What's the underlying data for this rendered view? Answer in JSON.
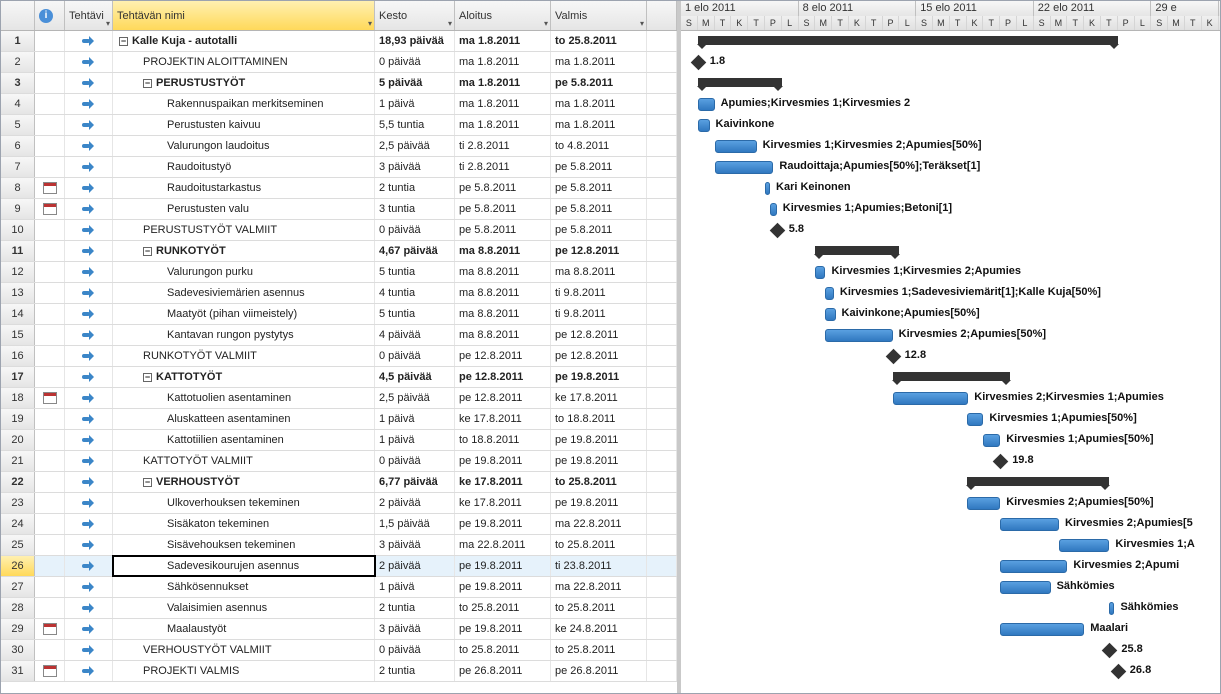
{
  "info_glyph": "i",
  "columns": {
    "rownum": "",
    "info": "",
    "tehtavi": "Tehtävi",
    "nimi": "Tehtävän nimi",
    "kesto": "Kesto",
    "aloitus": "Aloitus",
    "valmis": "Valmis"
  },
  "collapse_glyph": "−",
  "timeline": {
    "weeks": [
      {
        "label": "1 elo 2011",
        "days": 7
      },
      {
        "label": "8 elo 2011",
        "days": 7
      },
      {
        "label": "15 elo 2011",
        "days": 7
      },
      {
        "label": "22 elo 2011",
        "days": 7
      },
      {
        "label": "29 e",
        "days": 4
      }
    ],
    "day_letters": [
      "S",
      "M",
      "T",
      "K",
      "T",
      "P",
      "L"
    ]
  },
  "selected_row": 26,
  "rows": [
    {
      "n": 1,
      "bold": true,
      "indent": 0,
      "collapse": true,
      "name": "Kalle Kuja - autotalli",
      "kesto": "18,93 päivää",
      "aloitus": "ma 1.8.2011",
      "valmis": "to 25.8.2011",
      "bar": {
        "type": "summary",
        "start": 1,
        "len": 25
      },
      "label": ""
    },
    {
      "n": 2,
      "indent": 1,
      "name": "PROJEKTIN ALOITTAMINEN",
      "kesto": "0 päivää",
      "aloitus": "ma 1.8.2011",
      "valmis": "ma 1.8.2011",
      "bar": {
        "type": "milestone",
        "start": 1
      },
      "label": "1.8"
    },
    {
      "n": 3,
      "bold": true,
      "indent": 1,
      "collapse": true,
      "name": "PERUSTUSTYÖT",
      "kesto": "5 päivää",
      "aloitus": "ma 1.8.2011",
      "valmis": "pe 5.8.2011",
      "bar": {
        "type": "summary",
        "start": 1,
        "len": 5
      },
      "label": ""
    },
    {
      "n": 4,
      "indent": 2,
      "name": "Rakennuspaikan merkitseminen",
      "kesto": "1 päivä",
      "aloitus": "ma 1.8.2011",
      "valmis": "ma 1.8.2011",
      "bar": {
        "type": "task",
        "start": 1,
        "len": 1
      },
      "label": "Apumies;Kirvesmies 1;Kirvesmies 2"
    },
    {
      "n": 5,
      "indent": 2,
      "name": "Perustusten kaivuu",
      "kesto": "5,5 tuntia",
      "aloitus": "ma 1.8.2011",
      "valmis": "ma 1.8.2011",
      "bar": {
        "type": "task",
        "start": 1,
        "len": 0.7
      },
      "label": "Kaivinkone"
    },
    {
      "n": 6,
      "indent": 2,
      "name": "Valurungon laudoitus",
      "kesto": "2,5 päivää",
      "aloitus": "ti 2.8.2011",
      "valmis": "to 4.8.2011",
      "bar": {
        "type": "task",
        "start": 2,
        "len": 2.5
      },
      "label": "Kirvesmies 1;Kirvesmies 2;Apumies[50%]"
    },
    {
      "n": 7,
      "indent": 2,
      "name": "Raudoitustyö",
      "kesto": "3 päivää",
      "aloitus": "ti 2.8.2011",
      "valmis": "pe 5.8.2011",
      "bar": {
        "type": "task",
        "start": 2,
        "len": 3.5
      },
      "label": "Raudoittaja;Apumies[50%];Teräkset[1]"
    },
    {
      "n": 8,
      "cal": true,
      "indent": 2,
      "name": "Raudoitustarkastus",
      "kesto": "2 tuntia",
      "aloitus": "pe 5.8.2011",
      "valmis": "pe 5.8.2011",
      "bar": {
        "type": "task",
        "start": 5,
        "len": 0.3
      },
      "label": "Kari Keinonen"
    },
    {
      "n": 9,
      "cal": true,
      "indent": 2,
      "name": "Perustusten valu",
      "kesto": "3 tuntia",
      "aloitus": "pe 5.8.2011",
      "valmis": "pe 5.8.2011",
      "bar": {
        "type": "task",
        "start": 5.3,
        "len": 0.4
      },
      "label": "Kirvesmies 1;Apumies;Betoni[1]"
    },
    {
      "n": 10,
      "indent": 1,
      "name": "PERUSTUSTYÖT VALMIIT",
      "kesto": "0 päivää",
      "aloitus": "pe 5.8.2011",
      "valmis": "pe 5.8.2011",
      "bar": {
        "type": "milestone",
        "start": 5.7
      },
      "label": "5.8"
    },
    {
      "n": 11,
      "bold": true,
      "indent": 1,
      "collapse": true,
      "name": "RUNKOTYÖT",
      "kesto": "4,67 päivää",
      "aloitus": "ma 8.8.2011",
      "valmis": "pe 12.8.2011",
      "bar": {
        "type": "summary",
        "start": 8,
        "len": 5
      },
      "label": ""
    },
    {
      "n": 12,
      "indent": 2,
      "name": "Valurungon purku",
      "kesto": "5 tuntia",
      "aloitus": "ma 8.8.2011",
      "valmis": "ma 8.8.2011",
      "bar": {
        "type": "task",
        "start": 8,
        "len": 0.6
      },
      "label": "Kirvesmies 1;Kirvesmies 2;Apumies"
    },
    {
      "n": 13,
      "indent": 2,
      "name": "Sadevesiviemärien asennus",
      "kesto": "4 tuntia",
      "aloitus": "ma 8.8.2011",
      "valmis": "ti 9.8.2011",
      "bar": {
        "type": "task",
        "start": 8.6,
        "len": 0.5
      },
      "label": "Kirvesmies 1;Sadevesiviemärit[1];Kalle Kuja[50%]"
    },
    {
      "n": 14,
      "indent": 2,
      "name": "Maatyöt (pihan viimeistely)",
      "kesto": "5 tuntia",
      "aloitus": "ma 8.8.2011",
      "valmis": "ti 9.8.2011",
      "bar": {
        "type": "task",
        "start": 8.6,
        "len": 0.6
      },
      "label": "Kaivinkone;Apumies[50%]"
    },
    {
      "n": 15,
      "indent": 2,
      "name": "Kantavan rungon pystytys",
      "kesto": "4 päivää",
      "aloitus": "ma 8.8.2011",
      "valmis": "pe 12.8.2011",
      "bar": {
        "type": "task",
        "start": 8.6,
        "len": 4
      },
      "label": "Kirvesmies 2;Apumies[50%]"
    },
    {
      "n": 16,
      "indent": 1,
      "name": "RUNKOTYÖT VALMIIT",
      "kesto": "0 päivää",
      "aloitus": "pe 12.8.2011",
      "valmis": "pe 12.8.2011",
      "bar": {
        "type": "milestone",
        "start": 12.6
      },
      "label": "12.8"
    },
    {
      "n": 17,
      "bold": true,
      "indent": 1,
      "collapse": true,
      "name": "KATTOTYÖT",
      "kesto": "4,5 päivää",
      "aloitus": "pe 12.8.2011",
      "valmis": "pe 19.8.2011",
      "bar": {
        "type": "summary",
        "start": 12.6,
        "len": 7
      },
      "label": ""
    },
    {
      "n": 18,
      "cal": true,
      "indent": 2,
      "name": "Kattotuolien asentaminen",
      "kesto": "2,5 päivää",
      "aloitus": "pe 12.8.2011",
      "valmis": "ke 17.8.2011",
      "bar": {
        "type": "task",
        "start": 12.6,
        "len": 4.5
      },
      "label": "Kirvesmies 2;Kirvesmies 1;Apumies"
    },
    {
      "n": 19,
      "indent": 2,
      "name": "Aluskatteen asentaminen",
      "kesto": "1 päivä",
      "aloitus": "ke 17.8.2011",
      "valmis": "to 18.8.2011",
      "bar": {
        "type": "task",
        "start": 17,
        "len": 1
      },
      "label": "Kirvesmies 1;Apumies[50%]"
    },
    {
      "n": 20,
      "indent": 2,
      "name": "Kattotiilien asentaminen",
      "kesto": "1 päivä",
      "aloitus": "to 18.8.2011",
      "valmis": "pe 19.8.2011",
      "bar": {
        "type": "task",
        "start": 18,
        "len": 1
      },
      "label": "Kirvesmies 1;Apumies[50%]"
    },
    {
      "n": 21,
      "indent": 1,
      "name": "KATTOTYÖT VALMIIT",
      "kesto": "0 päivää",
      "aloitus": "pe 19.8.2011",
      "valmis": "pe 19.8.2011",
      "bar": {
        "type": "milestone",
        "start": 19
      },
      "label": "19.8"
    },
    {
      "n": 22,
      "bold": true,
      "indent": 1,
      "collapse": true,
      "name": "VERHOUSTYÖT",
      "kesto": "6,77 päivää",
      "aloitus": "ke 17.8.2011",
      "valmis": "to 25.8.2011",
      "bar": {
        "type": "summary",
        "start": 17,
        "len": 8.5
      },
      "label": ""
    },
    {
      "n": 23,
      "indent": 2,
      "name": "Ulkoverhouksen tekeminen",
      "kesto": "2 päivää",
      "aloitus": "ke 17.8.2011",
      "valmis": "pe 19.8.2011",
      "bar": {
        "type": "task",
        "start": 17,
        "len": 2
      },
      "label": "Kirvesmies 2;Apumies[50%]"
    },
    {
      "n": 24,
      "indent": 2,
      "name": "Sisäkaton tekeminen",
      "kesto": "1,5 päivää",
      "aloitus": "pe 19.8.2011",
      "valmis": "ma 22.8.2011",
      "bar": {
        "type": "task",
        "start": 19,
        "len": 3.5
      },
      "label": "Kirvesmies 2;Apumies[5"
    },
    {
      "n": 25,
      "indent": 2,
      "name": "Sisävehouksen tekeminen",
      "kesto": "3 päivää",
      "aloitus": "ma 22.8.2011",
      "valmis": "to 25.8.2011",
      "bar": {
        "type": "task",
        "start": 22.5,
        "len": 3
      },
      "label": "Kirvesmies 1;A"
    },
    {
      "n": 26,
      "indent": 2,
      "name": "Sadevesikourujen asennus",
      "kesto": "2 päivää",
      "aloitus": "pe 19.8.2011",
      "valmis": "ti 23.8.2011",
      "bar": {
        "type": "task",
        "start": 19,
        "len": 4
      },
      "label": "Kirvesmies 2;Apumi"
    },
    {
      "n": 27,
      "indent": 2,
      "name": "Sähkösennukset",
      "kesto": "1 päivä",
      "aloitus": "pe 19.8.2011",
      "valmis": "ma 22.8.2011",
      "bar": {
        "type": "task",
        "start": 19,
        "len": 3
      },
      "label": "Sähkömies"
    },
    {
      "n": 28,
      "indent": 2,
      "name": "Valaisimien asennus",
      "kesto": "2 tuntia",
      "aloitus": "to 25.8.2011",
      "valmis": "to 25.8.2011",
      "bar": {
        "type": "task",
        "start": 25.5,
        "len": 0.3
      },
      "label": "Sähkömies"
    },
    {
      "n": 29,
      "cal": true,
      "indent": 2,
      "name": "Maalaustyöt",
      "kesto": "3 päivää",
      "aloitus": "pe 19.8.2011",
      "valmis": "ke 24.8.2011",
      "bar": {
        "type": "task",
        "start": 19,
        "len": 5
      },
      "label": "Maalari"
    },
    {
      "n": 30,
      "indent": 1,
      "name": "VERHOUSTYÖT VALMIIT",
      "kesto": "0 päivää",
      "aloitus": "to 25.8.2011",
      "valmis": "to 25.8.2011",
      "bar": {
        "type": "milestone",
        "start": 25.5
      },
      "label": "25.8"
    },
    {
      "n": 31,
      "cal": true,
      "indent": 1,
      "name": "PROJEKTI VALMIS",
      "kesto": "2 tuntia",
      "aloitus": "pe 26.8.2011",
      "valmis": "pe 26.8.2011",
      "bar": {
        "type": "milestone",
        "start": 26
      },
      "label": "26.8"
    }
  ]
}
